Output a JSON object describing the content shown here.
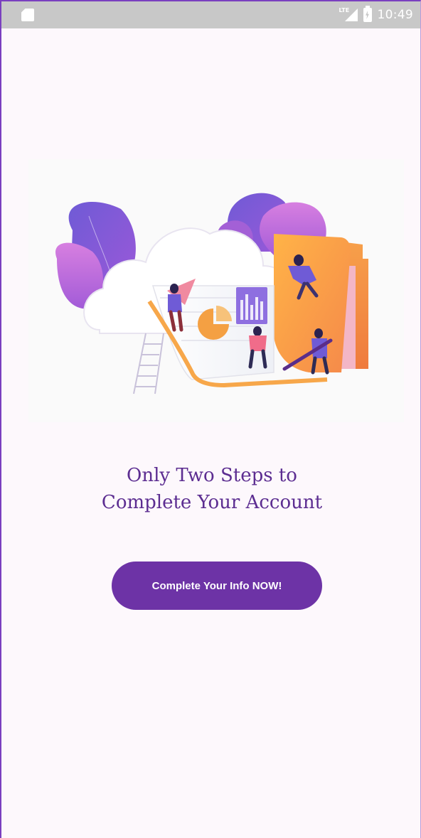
{
  "status_bar": {
    "network_label": "LTE",
    "time": "10:49",
    "icons": [
      "sd-card-icon",
      "lte-signal-icon",
      "battery-charging-icon"
    ]
  },
  "illustration": {
    "icon": "cloud-folder-team-illustration"
  },
  "headline": {
    "line1": "Only Two Steps to",
    "line2": "Complete Your Account"
  },
  "cta": {
    "label": "Complete Your Info NOW!"
  },
  "colors": {
    "accent": "#6d33a6",
    "headline": "#5c2d91",
    "background": "#fdf8fc",
    "status_bar": "#c8c8c8"
  }
}
